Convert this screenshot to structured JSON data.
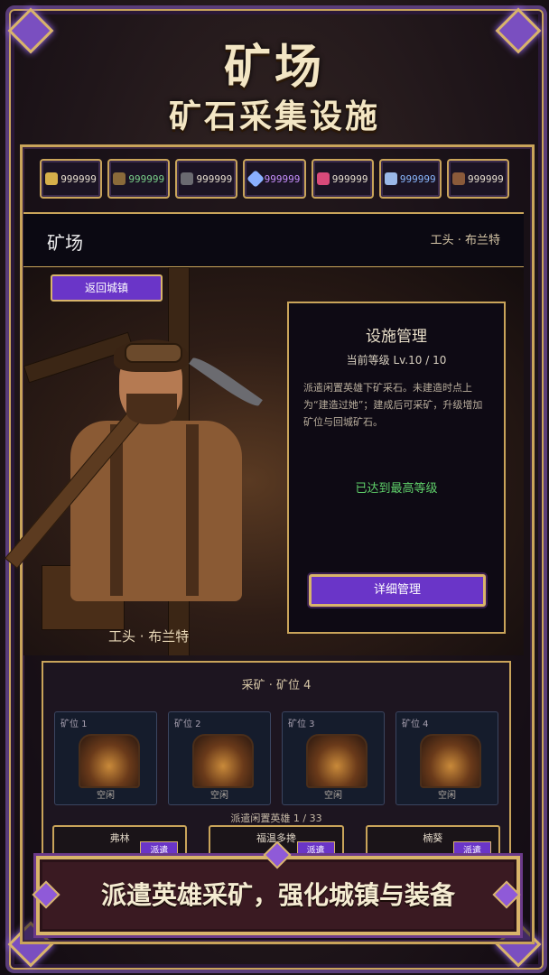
{
  "title": "矿场",
  "subtitle": "矿石采集设施",
  "resources": [
    {
      "icon": "coin-icon",
      "color": "#d6b04a",
      "value": "999999"
    },
    {
      "icon": "ore-pile-icon",
      "color": "#8a6a3a",
      "value": "999999"
    },
    {
      "icon": "stone-icon",
      "color": "#6a6a70",
      "value": "999999"
    },
    {
      "icon": "crystal-icon",
      "color": "#8ab0ff",
      "value": "999999"
    },
    {
      "icon": "scroll-icon",
      "color": "#d84a7a",
      "value": "999999"
    },
    {
      "icon": "rune-icon",
      "color": "#9ab8e8",
      "value": "999999"
    },
    {
      "icon": "misc-icon",
      "color": "#8a5a3a",
      "value": "999999"
    }
  ],
  "header": {
    "name": "矿场",
    "boss": "工头 · 布兰特"
  },
  "back_button": "返回城镇",
  "boss_label": "工头 · 布兰特",
  "management": {
    "title": "设施管理",
    "level": "当前等级  Lv.10 / 10",
    "description": "派遣闲置英雄下矿采石。未建造时点上为“建造过她”；建成后可采矿，升级增加矿位与回城矿石。",
    "max_text": "已达到最高等级",
    "detail_button": "详细管理"
  },
  "mining": {
    "title": "采矿  ·  矿位 4",
    "slots": [
      {
        "label": "矿位 1",
        "status": "空闲"
      },
      {
        "label": "矿位 2",
        "status": "空闲"
      },
      {
        "label": "矿位 3",
        "status": "空闲"
      },
      {
        "label": "矿位 4",
        "status": "空闲"
      }
    ],
    "dispatch": "派遣闲置英雄  1 / 33",
    "heroes": [
      {
        "name": "弗林",
        "button": "派遣"
      },
      {
        "name": "福温多搀",
        "button": "派遣"
      },
      {
        "name": "楠葵",
        "button": "派遣"
      }
    ]
  },
  "banner": "派遣英雄采矿，强化城镇与装备"
}
